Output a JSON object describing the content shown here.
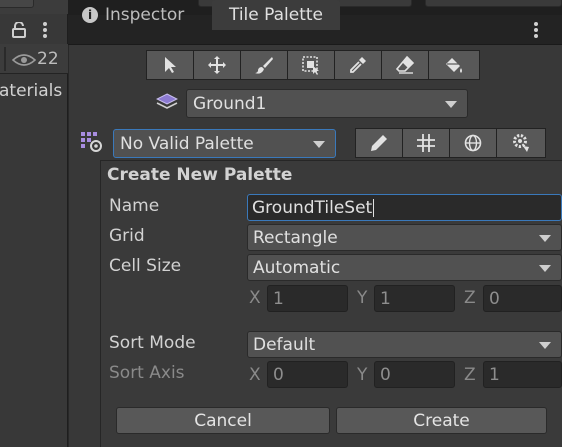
{
  "left_panel": {
    "eye_count": "22",
    "partial_label": "aterials"
  },
  "tabs": [
    {
      "label": "Inspector",
      "active": false
    },
    {
      "label": "Tile Palette",
      "active": true
    }
  ],
  "tools": [
    "select-icon",
    "move-icon",
    "paint-brush-icon",
    "box-fill-icon",
    "picker-icon",
    "eraser-icon",
    "fill-bucket-icon"
  ],
  "tilemap_dropdown": {
    "value": "Ground1"
  },
  "palette_dropdown": {
    "value": "No Valid Palette"
  },
  "palette_tools": [
    "edit-icon",
    "grid-icon",
    "gizmo-icon",
    "settings-icon"
  ],
  "create_palette": {
    "title": "Create New Palette",
    "name_label": "Name",
    "name_value": "GroundTileSet",
    "grid_label": "Grid",
    "grid_value": "Rectangle",
    "cell_size_label": "Cell Size",
    "cell_size_value": "Automatic",
    "cell_size_xyz": {
      "x_label": "X",
      "x": "1",
      "y_label": "Y",
      "y": "1",
      "z_label": "Z",
      "z": "0"
    },
    "sort_mode_label": "Sort Mode",
    "sort_mode_value": "Default",
    "sort_axis_label": "Sort Axis",
    "sort_axis_xyz": {
      "x_label": "X",
      "x": "0",
      "y_label": "Y",
      "y": "0",
      "z_label": "Z",
      "z": "1"
    },
    "cancel_label": "Cancel",
    "create_label": "Create"
  },
  "colors": {
    "accent_focus": "#3a79bb",
    "panel": "#383838",
    "button": "#585858"
  }
}
